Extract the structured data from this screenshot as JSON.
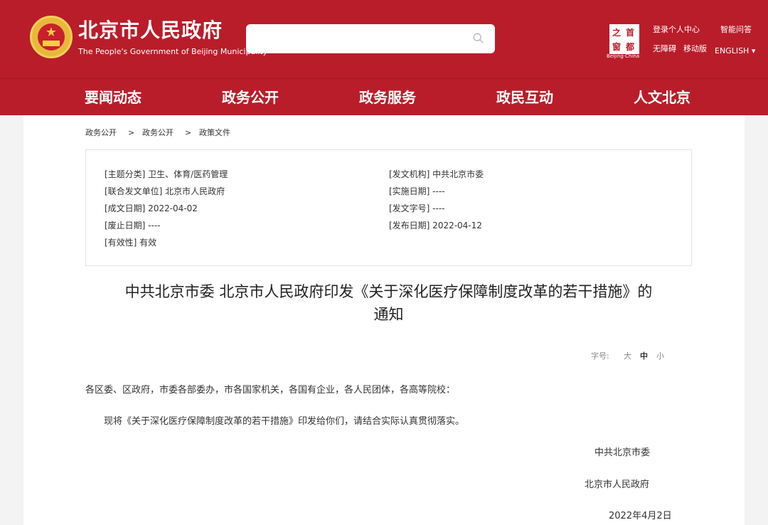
{
  "header": {
    "site_title": "北京市人民政府",
    "site_subtitle": "The People's Government of Beijing Municipality",
    "search_placeholder": "",
    "capital_logo": {
      "chars": [
        "之",
        "首",
        "窗",
        "都"
      ],
      "caption": "Beijing·China"
    },
    "links": {
      "login": "登录个人中心",
      "smart_qa": "智能问答",
      "accessibility": "无障碍",
      "mobile": "移动版",
      "english": "ENGLISH ▾"
    }
  },
  "nav": [
    "要闻动态",
    "政务公开",
    "政务服务",
    "政民互动",
    "人文北京"
  ],
  "breadcrumb": [
    "政务公开",
    ">",
    "政务公开",
    ">",
    "政策文件"
  ],
  "meta": {
    "topic": "[主题分类] 卫生、体育/医药管理",
    "issuer": "[发文机构] 中共北京市委",
    "joint": "[联合发文单位] 北京市人民政府",
    "effective_date": "[实施日期] ----",
    "created_date": "[成文日期] 2022-04-02",
    "doc_number": "[发文字号] ----",
    "expiry_date": "[废止日期] ----",
    "publish_date": "[发布日期] 2022-04-12",
    "validity": "[有效性] 有效"
  },
  "article": {
    "title_line1": "中共北京市委 北京市人民政府印发《关于深化医疗保障制度改革的若干措施》的",
    "title_line2": "通知",
    "font_size_label": "字号:",
    "font_sizes": [
      "大",
      "中",
      "小"
    ],
    "salutation": "各区委、区政府，市委各部委办，市各国家机关，各国有企业，各人民团体，各高等院校：",
    "paragraph": "现将《关于深化医疗保障制度改革的若干措施》印发给你们，请结合实际认真贯彻落实。",
    "signature1": "中共北京市委",
    "signature2": "北京市人民政府",
    "date": "2022年4月2日"
  },
  "colors": {
    "brand_red": "#b91d2a",
    "background": "#f3f3f3"
  }
}
